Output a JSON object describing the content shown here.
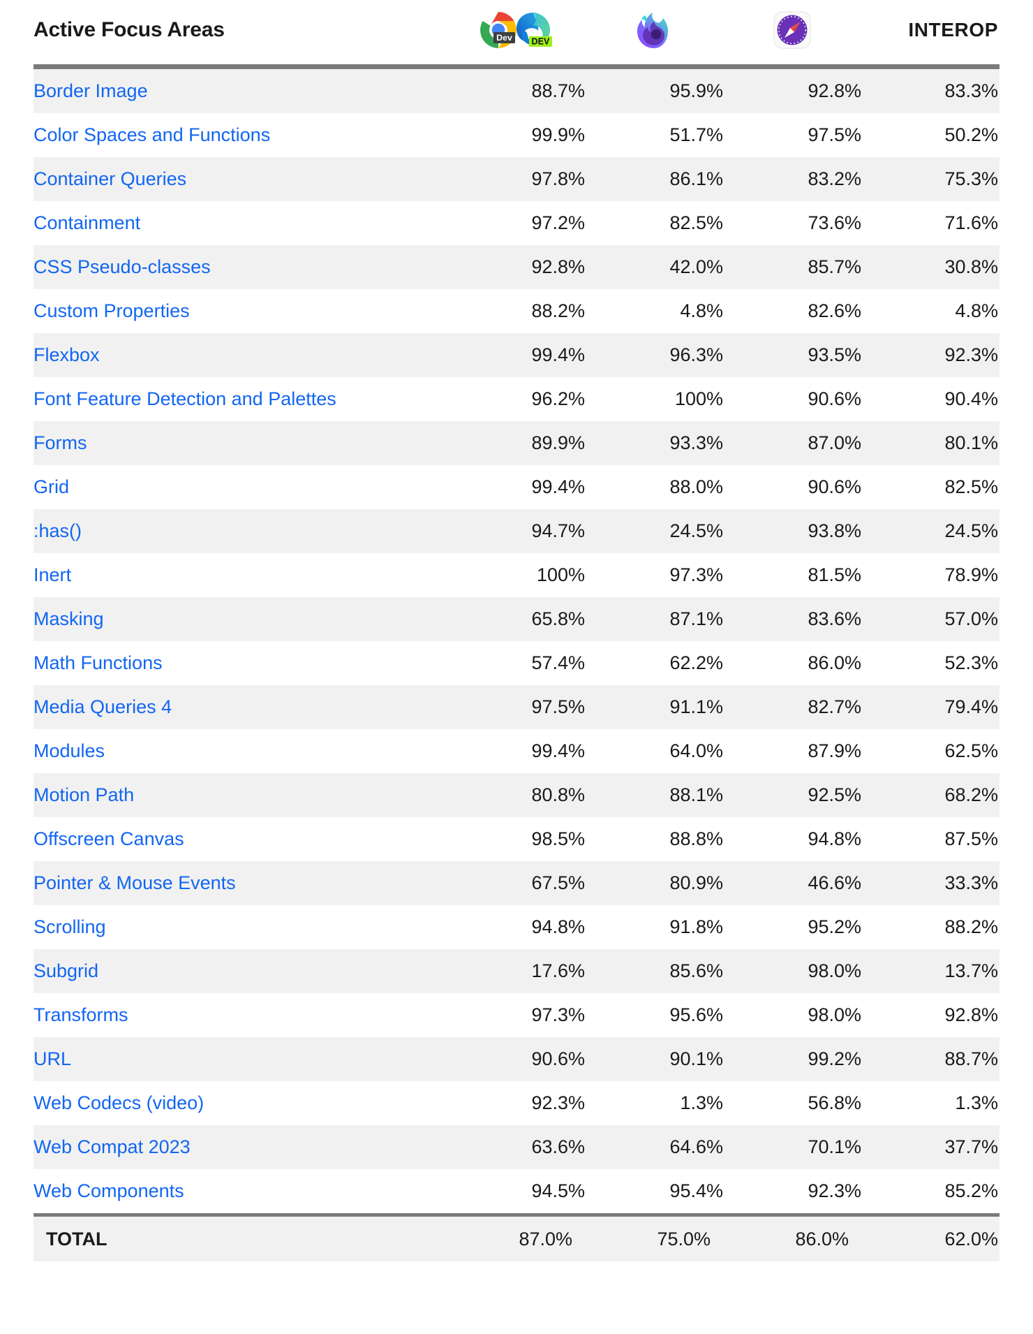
{
  "table": {
    "title": "Active Focus Areas",
    "columns": [
      {
        "key": "feature",
        "label": "Active Focus Areas",
        "icon": "none"
      },
      {
        "key": "chrome_edge",
        "label": "",
        "icon": "chrome-dev-edge-dev-icon"
      },
      {
        "key": "firefox",
        "label": "",
        "icon": "firefox-icon"
      },
      {
        "key": "safari",
        "label": "",
        "icon": "safari-icon"
      },
      {
        "key": "interop",
        "label": "INTEROP",
        "icon": "none"
      }
    ],
    "rows": [
      {
        "feature": "Border Image",
        "chrome_edge": "88.7%",
        "firefox": "95.9%",
        "safari": "92.8%",
        "interop": "83.3%"
      },
      {
        "feature": "Color Spaces and Functions",
        "chrome_edge": "99.9%",
        "firefox": "51.7%",
        "safari": "97.5%",
        "interop": "50.2%"
      },
      {
        "feature": "Container Queries",
        "chrome_edge": "97.8%",
        "firefox": "86.1%",
        "safari": "83.2%",
        "interop": "75.3%"
      },
      {
        "feature": "Containment",
        "chrome_edge": "97.2%",
        "firefox": "82.5%",
        "safari": "73.6%",
        "interop": "71.6%"
      },
      {
        "feature": "CSS Pseudo-classes",
        "chrome_edge": "92.8%",
        "firefox": "42.0%",
        "safari": "85.7%",
        "interop": "30.8%"
      },
      {
        "feature": "Custom Properties",
        "chrome_edge": "88.2%",
        "firefox": "4.8%",
        "safari": "82.6%",
        "interop": "4.8%"
      },
      {
        "feature": "Flexbox",
        "chrome_edge": "99.4%",
        "firefox": "96.3%",
        "safari": "93.5%",
        "interop": "92.3%"
      },
      {
        "feature": "Font Feature Detection and Palettes",
        "chrome_edge": "96.2%",
        "firefox": "100%",
        "safari": "90.6%",
        "interop": "90.4%"
      },
      {
        "feature": "Forms",
        "chrome_edge": "89.9%",
        "firefox": "93.3%",
        "safari": "87.0%",
        "interop": "80.1%"
      },
      {
        "feature": "Grid",
        "chrome_edge": "99.4%",
        "firefox": "88.0%",
        "safari": "90.6%",
        "interop": "82.5%"
      },
      {
        "feature": ":has()",
        "chrome_edge": "94.7%",
        "firefox": "24.5%",
        "safari": "93.8%",
        "interop": "24.5%"
      },
      {
        "feature": "Inert",
        "chrome_edge": "100%",
        "firefox": "97.3%",
        "safari": "81.5%",
        "interop": "78.9%"
      },
      {
        "feature": "Masking",
        "chrome_edge": "65.8%",
        "firefox": "87.1%",
        "safari": "83.6%",
        "interop": "57.0%"
      },
      {
        "feature": "Math Functions",
        "chrome_edge": "57.4%",
        "firefox": "62.2%",
        "safari": "86.0%",
        "interop": "52.3%"
      },
      {
        "feature": "Media Queries 4",
        "chrome_edge": "97.5%",
        "firefox": "91.1%",
        "safari": "82.7%",
        "interop": "79.4%"
      },
      {
        "feature": "Modules",
        "chrome_edge": "99.4%",
        "firefox": "64.0%",
        "safari": "87.9%",
        "interop": "62.5%"
      },
      {
        "feature": "Motion Path",
        "chrome_edge": "80.8%",
        "firefox": "88.1%",
        "safari": "92.5%",
        "interop": "68.2%"
      },
      {
        "feature": "Offscreen Canvas",
        "chrome_edge": "98.5%",
        "firefox": "88.8%",
        "safari": "94.8%",
        "interop": "87.5%"
      },
      {
        "feature": "Pointer & Mouse Events",
        "chrome_edge": "67.5%",
        "firefox": "80.9%",
        "safari": "46.6%",
        "interop": "33.3%"
      },
      {
        "feature": "Scrolling",
        "chrome_edge": "94.8%",
        "firefox": "91.8%",
        "safari": "95.2%",
        "interop": "88.2%"
      },
      {
        "feature": "Subgrid",
        "chrome_edge": "17.6%",
        "firefox": "85.6%",
        "safari": "98.0%",
        "interop": "13.7%"
      },
      {
        "feature": "Transforms",
        "chrome_edge": "97.3%",
        "firefox": "95.6%",
        "safari": "98.0%",
        "interop": "92.8%"
      },
      {
        "feature": "URL",
        "chrome_edge": "90.6%",
        "firefox": "90.1%",
        "safari": "99.2%",
        "interop": "88.7%"
      },
      {
        "feature": "Web Codecs (video)",
        "chrome_edge": "92.3%",
        "firefox": "1.3%",
        "safari": "56.8%",
        "interop": "1.3%"
      },
      {
        "feature": "Web Compat 2023",
        "chrome_edge": "63.6%",
        "firefox": "64.6%",
        "safari": "70.1%",
        "interop": "37.7%"
      },
      {
        "feature": "Web Components",
        "chrome_edge": "94.5%",
        "firefox": "95.4%",
        "safari": "92.3%",
        "interop": "85.2%"
      }
    ],
    "total": {
      "label": "TOTAL",
      "chrome_edge": "87.0%",
      "firefox": "75.0%",
      "safari": "86.0%",
      "interop": "62.0%"
    }
  },
  "colors": {
    "link": "#1266f1",
    "text": "#1a1a1a",
    "row_shade": "#f1f1f1",
    "rule": "#7a7a7a",
    "chrome_red": "#ea4335",
    "chrome_yellow": "#fbbc05",
    "chrome_green": "#34a853",
    "chrome_blue": "#4285f4",
    "edge_blue": "#0f7fd4",
    "edge_teal": "#37c5d6",
    "edge_green": "#57d18a",
    "firefox_orange": "#ff980e",
    "firefox_purple": "#9059ff",
    "safari_purple": "#6a31b6",
    "dev_badge_green": "#9ef01a"
  },
  "badges": {
    "chrome_dev": "Dev",
    "edge_dev": "DEV"
  }
}
